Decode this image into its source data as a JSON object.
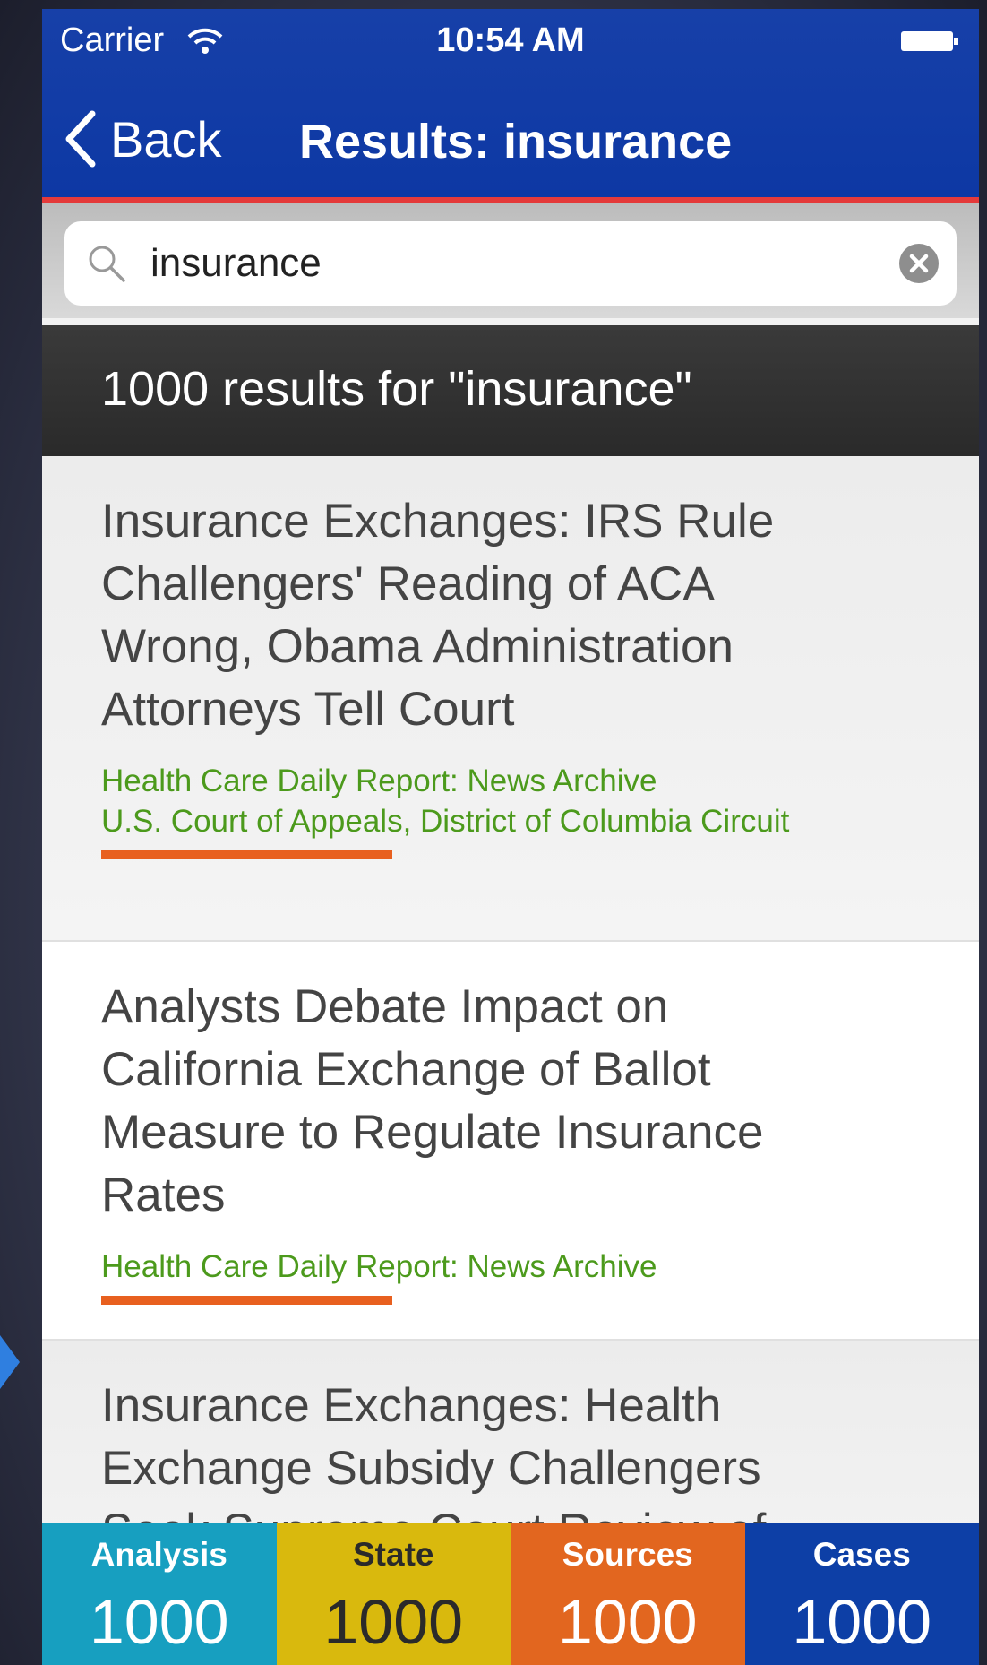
{
  "status_bar": {
    "carrier": "Carrier",
    "time": "10:54 AM"
  },
  "nav": {
    "back_label": "Back",
    "title": "Results: insurance"
  },
  "search": {
    "value": "insurance"
  },
  "results_header": "1000 results for \"insurance\"",
  "results": [
    {
      "title": "Insurance Exchanges: IRS Rule Challengers' Reading of ACA Wrong, Obama Administration Attorneys Tell Court",
      "sources": [
        "Health Care Daily Report: News Archive",
        "U.S. Court of Appeals, District of Columbia Circuit"
      ]
    },
    {
      "title": "Analysts Debate Impact on California Exchange of Ballot Measure to Regulate Insurance Rates",
      "sources": [
        "Health Care Daily Report: News Archive"
      ]
    },
    {
      "title": "Insurance Exchanges: Health Exchange Subsidy Challengers Seek Supreme Court Review of"
    }
  ],
  "tabs": [
    {
      "label": "Analysis",
      "count": "1000"
    },
    {
      "label": "State",
      "count": "1000"
    },
    {
      "label": "Sources",
      "count": "1000"
    },
    {
      "label": "Cases",
      "count": "1000"
    }
  ],
  "colors": {
    "nav_blue": "#0d38a4",
    "accent_red": "#e43a3a",
    "source_green": "#4c9a1c",
    "underline_orange": "#e8601f",
    "tab_analysis": "#179fc0",
    "tab_state": "#d9b90d",
    "tab_sources": "#e2661f",
    "tab_cases": "#0d3fa6"
  }
}
